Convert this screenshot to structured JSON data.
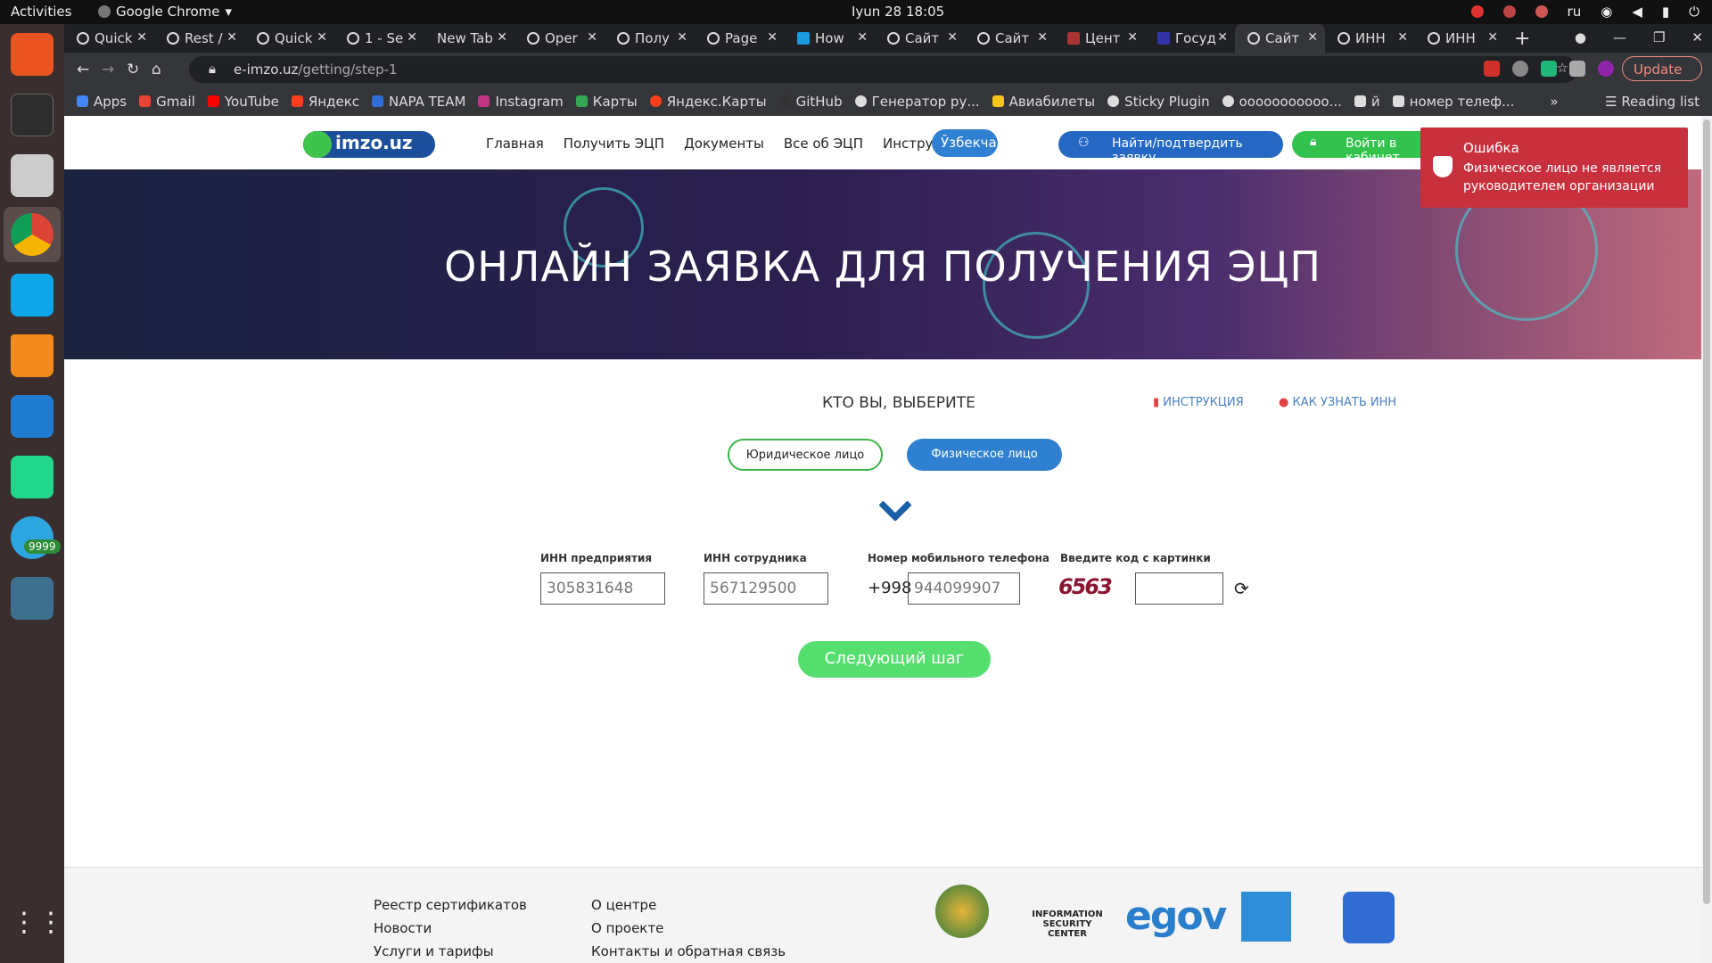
{
  "system": {
    "activities": "Activities",
    "app_name": "Google Chrome",
    "clock": "Iyun 28  18:05",
    "lang": "ru"
  },
  "dock": {
    "telegram_badge": "9999"
  },
  "tabs": [
    "Quick",
    "Rest /",
    "Quick",
    "1 - Se",
    "New Tab",
    "Oper",
    "Полу",
    "Page",
    "How",
    "Сайт",
    "Сайт",
    "Цент",
    "Госуд",
    "Сайт",
    "ИНН",
    "ИНН"
  ],
  "address": {
    "domain": "e-imzo.uz",
    "path": "/getting/step-1"
  },
  "update_label": "Update",
  "bookmarks": [
    "Apps",
    "Gmail",
    "YouTube",
    "Яндекс",
    "NAPA TEAM",
    "Instagram",
    "Карты",
    "Яндекс.Карты",
    "GitHub",
    "Генератор ру...",
    "Авиабилеты",
    "Sticky Plugin",
    "ооооооооооо...",
    "й",
    "номер телеф..."
  ],
  "reading_list": "Reading list",
  "site": {
    "logo": "imzo.uz",
    "menu": [
      "Главная",
      "Получить ЭЦП",
      "Документы",
      "Все об ЭЦП",
      "Инструкции"
    ],
    "lang_button": "Ўзбекча",
    "find_button": "Найти/подтвердить заявку",
    "login_button": "Войти в кабинет",
    "hero_title": "ОНЛАЙН ЗАЯВКА ДЛЯ ПОЛУЧЕНИЯ ЭЦП",
    "who_label": "КТО ВЫ, ВЫБЕРИТЕ",
    "instruction_link": "ИНСТРУКЦИЯ",
    "howinn_link": "КАК УЗНАТЬ ИНН",
    "legal_button": "Юридическое лицо",
    "physical_button": "Физическое лицо",
    "fields": {
      "company_inn": {
        "label": "ИНН предприятия",
        "value": "305831648"
      },
      "employee_inn": {
        "label": "ИНН сотрудника",
        "value": "567129500"
      },
      "phone": {
        "label": "Номер мобильного телефона",
        "prefix": "+998",
        "value": "944099907"
      },
      "captcha": {
        "label": "Введите код с картинки",
        "image_text": "6563",
        "value": ""
      }
    },
    "next_button": "Следующий шаг",
    "footer": {
      "col1": [
        "Реестр сертификатов",
        "Новости",
        "Услуги и тарифы"
      ],
      "col2": [
        "О центре",
        "О проекте",
        "Контакты и обратная связь"
      ],
      "infosec_logo": "INFORMATION SECURITY CENTER",
      "egov_logo": "egov"
    }
  },
  "toast": {
    "title": "Ошибка",
    "message": "Физическое лицо не является руководителем организации"
  }
}
